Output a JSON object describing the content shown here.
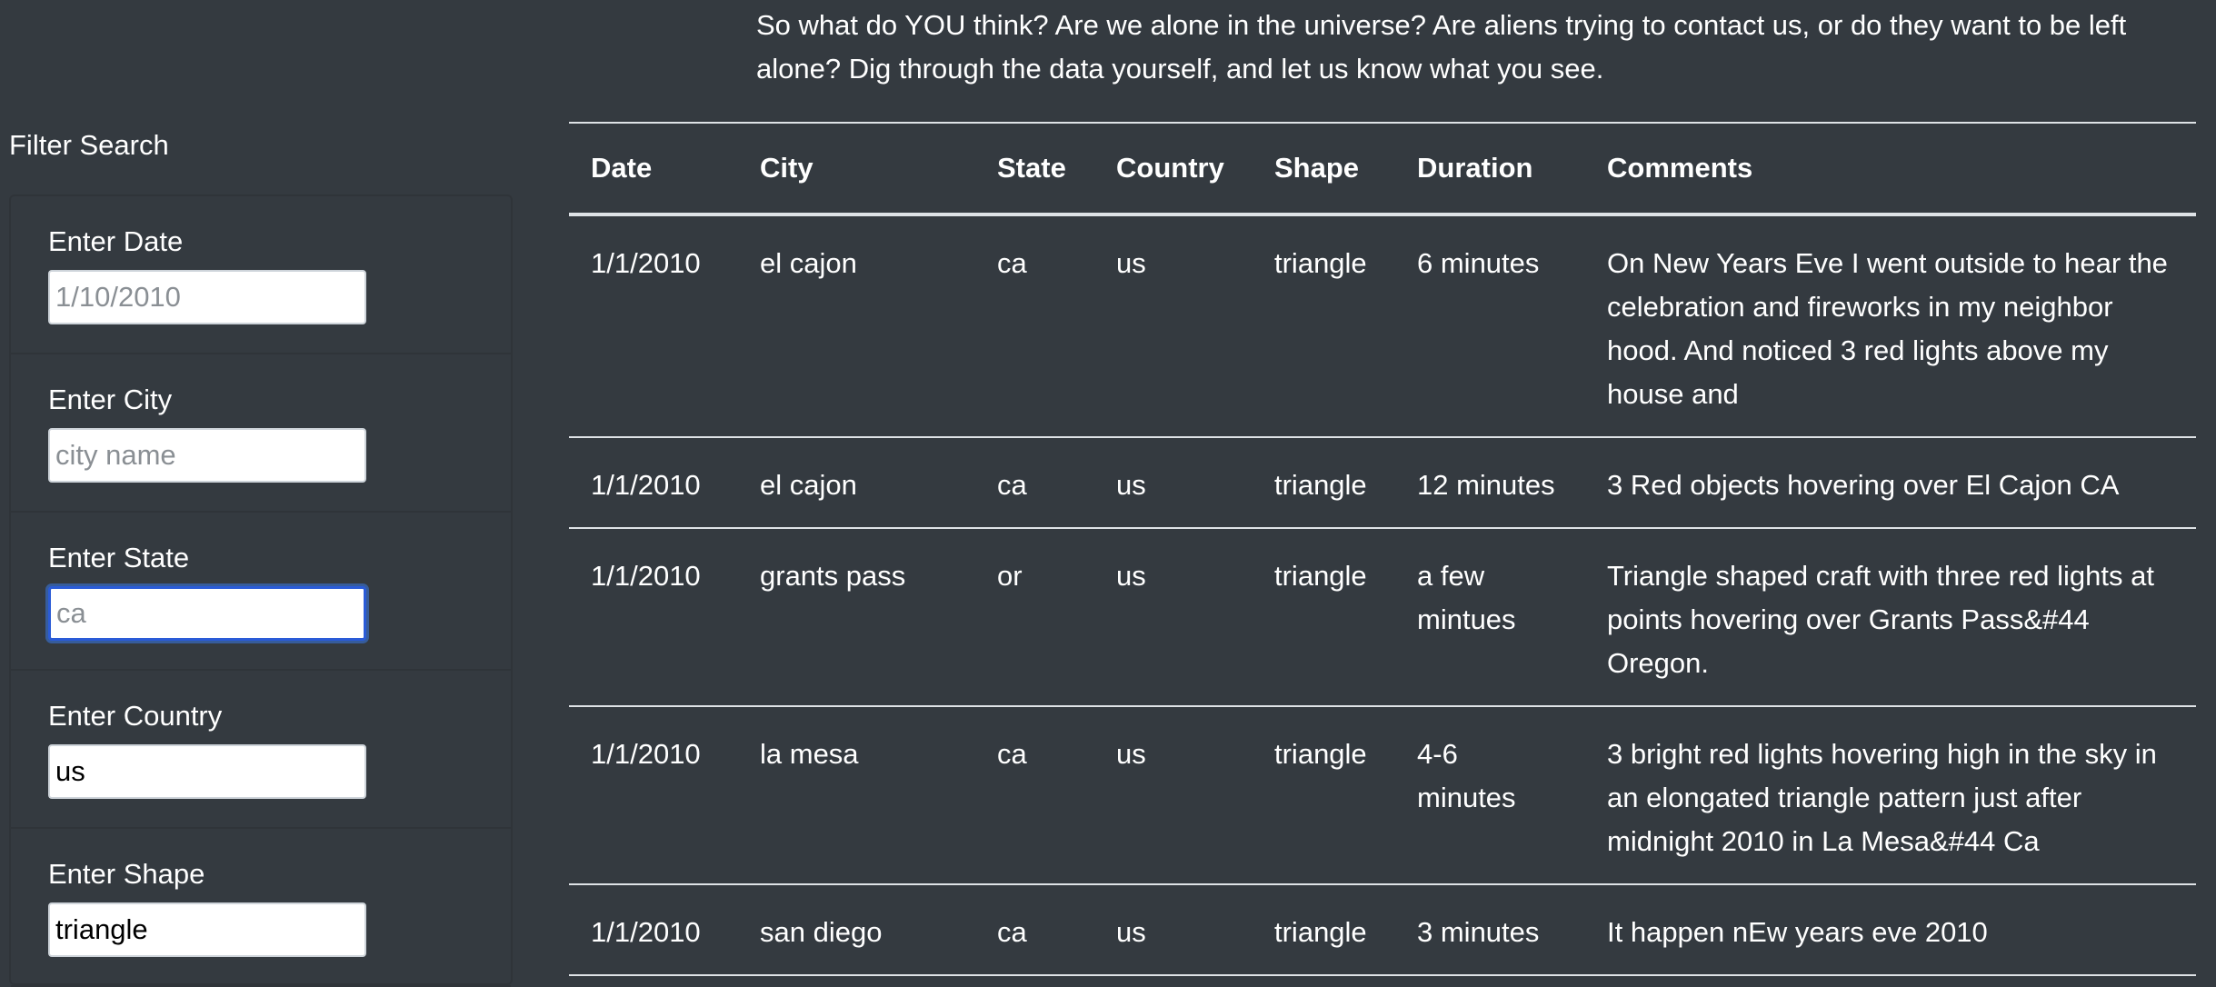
{
  "intro_text": "So what do YOU think? Are we alone in the universe? Are aliens trying to contact us, or do they want to be left alone? Dig through the data yourself, and let us know what you see.",
  "filter": {
    "title": "Filter Search",
    "fields": [
      {
        "label": "Enter Date",
        "placeholder": "1/10/2010",
        "value": ""
      },
      {
        "label": "Enter City",
        "placeholder": "city name",
        "value": ""
      },
      {
        "label": "Enter State",
        "placeholder": "ca",
        "value": ""
      },
      {
        "label": "Enter Country",
        "placeholder": "",
        "value": "us"
      },
      {
        "label": "Enter Shape",
        "placeholder": "",
        "value": "triangle"
      }
    ]
  },
  "table": {
    "headers": [
      "Date",
      "City",
      "State",
      "Country",
      "Shape",
      "Duration",
      "Comments"
    ],
    "rows": [
      [
        "1/1/2010",
        "el cajon",
        "ca",
        "us",
        "triangle",
        "6 minutes",
        "On New Years Eve I went outside to hear the celebration and fireworks in my neighbor hood. And noticed 3 red lights above my house and"
      ],
      [
        "1/1/2010",
        "el cajon",
        "ca",
        "us",
        "triangle",
        "12 minutes",
        "3 Red objects hovering over El Cajon CA"
      ],
      [
        "1/1/2010",
        "grants pass",
        "or",
        "us",
        "triangle",
        "a few mintues",
        "Triangle shaped craft with three red lights at points hovering over Grants Pass&#44 Oregon."
      ],
      [
        "1/1/2010",
        "la mesa",
        "ca",
        "us",
        "triangle",
        "4-6 minutes",
        "3 bright red lights hovering high in the sky in an elongated triangle pattern just after midnight 2010 in La Mesa&#44 Ca"
      ],
      [
        "1/1/2010",
        "san diego",
        "ca",
        "us",
        "triangle",
        "3 minutes",
        "It happen nEw years eve 2010"
      ]
    ]
  },
  "colors": {
    "background": "#343a40",
    "text": "#ffffff",
    "table_border": "#dee2e6",
    "focus_ring": "#2a5bd7"
  }
}
